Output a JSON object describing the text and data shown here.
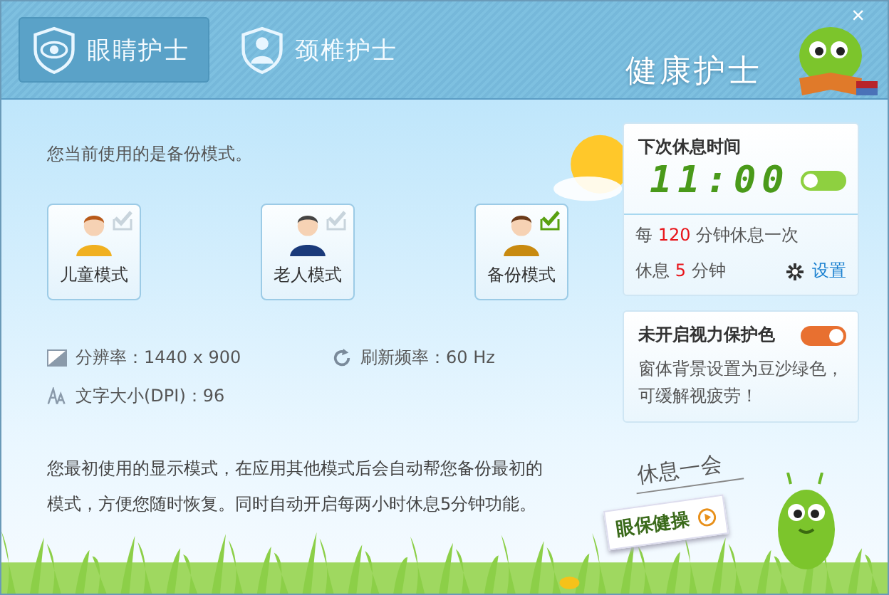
{
  "window": {
    "title": "健康护士",
    "close": "×"
  },
  "tabs": [
    {
      "label": "眼睛护士",
      "kind": "eye",
      "selected": true
    },
    {
      "label": "颈椎护士",
      "kind": "neck",
      "selected": false
    }
  ],
  "current_mode_text": "您当前使用的是备份模式。",
  "modes": [
    {
      "label": "儿童模式",
      "kind": "child",
      "checked": false
    },
    {
      "label": "老人模式",
      "kind": "elder",
      "checked": false
    },
    {
      "label": "备份模式",
      "kind": "backup",
      "checked": true
    }
  ],
  "display_info": [
    {
      "kind": "resolution",
      "text": "分辨率：1440 x 900"
    },
    {
      "kind": "refresh",
      "text": "刷新频率：60 Hz"
    },
    {
      "kind": "dpi",
      "text": "文字大小(DPI)：96"
    }
  ],
  "description": "您最初使用的显示模式，在应用其他模式后会自动帮您备份最初的模式，方便您随时恢复。同时自动开启每两小时休息5分钟功能。",
  "rest_panel": {
    "title": "下次休息时间",
    "time": "11:00",
    "on": false,
    "interval_prefix": "每",
    "interval_value": "120",
    "interval_suffix": "分钟休息一次",
    "duration_prefix": "休息",
    "duration_value": "5",
    "duration_suffix": "分钟",
    "settings_link": "设置"
  },
  "protect_panel": {
    "title": "未开启视力保护色",
    "on": true,
    "text": "窗体背景设置为豆沙绿色，可缓解视疲劳！"
  },
  "break_sign": "休息一会",
  "eye_exercise_button": "眼保健操"
}
